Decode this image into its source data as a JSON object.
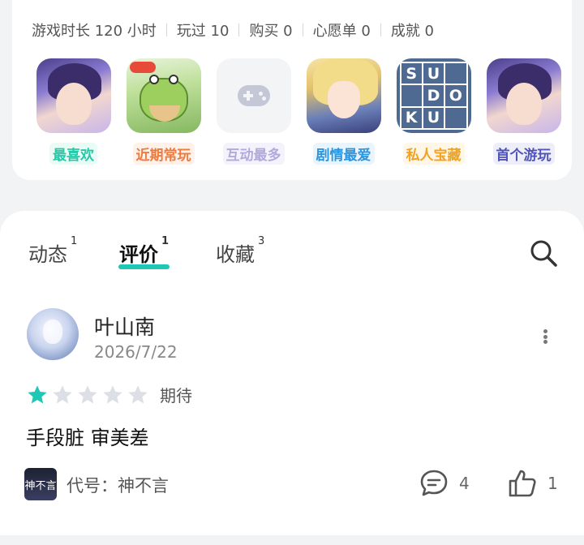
{
  "stats": {
    "play_time": "游戏时长 120 小时",
    "played": "玩过 10",
    "purchased": "购买 0",
    "wishlist": "心愿单 0",
    "achievements": "成就 0"
  },
  "badges": [
    {
      "label": "最喜欢",
      "color": "#25c9a7",
      "bg": "#eafaf5",
      "art": "anime-boy"
    },
    {
      "label": "近期常玩",
      "color": "#f07a3d",
      "bg": "#fdf1ea",
      "art": "travel-frog"
    },
    {
      "label": "互动最多",
      "color": "#b2a9dd",
      "bg": "#f4f2fb",
      "art": "gamepad-placeholder"
    },
    {
      "label": "剧情最爱",
      "color": "#2a96e0",
      "bg": "#e9f4fc",
      "art": "anime-blonde"
    },
    {
      "label": "私人宝藏",
      "color": "#f2a21e",
      "bg": "#fef6e6",
      "art": "sudoku"
    },
    {
      "label": "首个游玩",
      "color": "#5054b8",
      "bg": "#eeeef9",
      "art": "anime-boy"
    }
  ],
  "sudoku_letters": [
    "S",
    "U",
    "",
    "",
    "D",
    "O",
    "K",
    "U",
    ""
  ],
  "tabs": [
    {
      "label": "动态",
      "count": "1",
      "active": false
    },
    {
      "label": "评价",
      "count": "1",
      "active": true
    },
    {
      "label": "收藏",
      "count": "3",
      "active": false
    }
  ],
  "review": {
    "username": "叶山南",
    "date": "2026/7/22",
    "rating": 1,
    "rating_max": 5,
    "rating_label": "期待",
    "text": "手段脏 审美差",
    "game_thumb_text": "神不言",
    "game_name": "代号：神不言",
    "comments": "4",
    "likes": "1"
  },
  "colors": {
    "accent": "#1ec8b4",
    "star_on": "#1ec8b4",
    "star_off": "#dcdfe5"
  },
  "icons": {
    "search": "search-icon",
    "more": "more-vertical-icon",
    "comment": "comment-icon",
    "like": "thumbs-up-icon",
    "star": "star-icon"
  }
}
